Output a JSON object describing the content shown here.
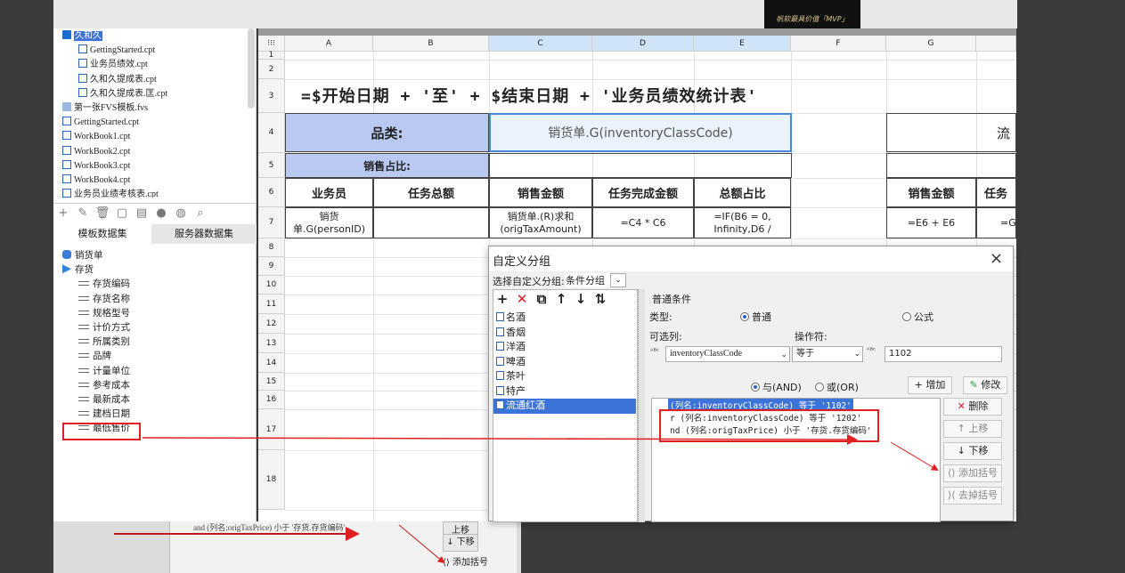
{
  "colors": {
    "accent": "#3b73d8",
    "annotation_red": "#e02020",
    "header_blue": "#b9c9f2"
  },
  "background": {
    "mvp_badge": "帆软最具价值「MVP」",
    "bottom_ghost": {
      "cond_text": "and (列名:origTaxPrice) 小于 '存货.存货编码'",
      "up": "上移",
      "down": "下移",
      "add_paren": "添加括号"
    }
  },
  "file_tree": {
    "items": [
      {
        "label": "久和久",
        "type": "folder",
        "indent": 0,
        "selected": true
      },
      {
        "label": "GettingStarted.cpt",
        "type": "file",
        "indent": 1
      },
      {
        "label": "业务员绩效.cpt",
        "type": "file",
        "indent": 1
      },
      {
        "label": "久和久提成表.cpt",
        "type": "file",
        "indent": 1
      },
      {
        "label": "久和久提成表.匡.cpt",
        "type": "file",
        "indent": 1
      },
      {
        "label": "第一张FVS模板.fvs",
        "type": "fvs",
        "indent": 0
      },
      {
        "label": "GettingStarted.cpt",
        "type": "file",
        "indent": 0
      },
      {
        "label": "WorkBook1.cpt",
        "type": "file",
        "indent": 0
      },
      {
        "label": "WorkBook2.cpt",
        "type": "file",
        "indent": 0
      },
      {
        "label": "WorkBook3.cpt",
        "type": "file",
        "indent": 0
      },
      {
        "label": "WorkBook4.cpt",
        "type": "file",
        "indent": 0
      },
      {
        "label": "业务员业绩考核表.cpt",
        "type": "file",
        "indent": 0
      }
    ]
  },
  "dataset_panel": {
    "toolbar_icons": [
      "add-icon",
      "edit-icon",
      "delete-icon",
      "preview-icon",
      "server-icon",
      "db-icon",
      "db2-icon",
      "search-icon"
    ],
    "tabs": {
      "template": "模板数据集",
      "server": "服务器数据集"
    },
    "datasets": [
      {
        "label": "销货单",
        "kind": "db"
      },
      {
        "label": "存货",
        "kind": "table"
      }
    ],
    "fields": [
      "存货编码",
      "存货名称",
      "规格型号",
      "计价方式",
      "所属类别",
      "品牌",
      "计量单位",
      "参考成本",
      "最新成本",
      "建档日期",
      "最低售价"
    ]
  },
  "sheet": {
    "columns": [
      "A",
      "B",
      "C",
      "D",
      "E",
      "F",
      "G",
      ""
    ],
    "rows": [
      "1",
      "2",
      "3",
      "4",
      "5",
      "6",
      "7",
      "8",
      "9",
      "10",
      "11",
      "12",
      "13",
      "14",
      "15",
      "16",
      "17",
      "18"
    ],
    "title": "=$开始日期 + '至' + $结束日期 + '业务员绩效统计表'",
    "category_label": "品类:",
    "category_value": "销货单.G(inventoryClassCode)",
    "sales_share": "销售占比:",
    "right_label": "流",
    "headers": [
      "业务员",
      "任务总额",
      "销售金额",
      "任务完成金额",
      "总额占比",
      "销售金额",
      "任务"
    ],
    "row6": [
      "销货单.G(personID)",
      "",
      "销货单.(R)求和(origTaxAmount)",
      "=C4 * C6",
      "=IF(B6 = 0, Infinity,D6 /",
      "=E6 + E6",
      "=G"
    ]
  },
  "dialog": {
    "title": "自定义分组",
    "select_label": "选择自定义分组:",
    "select_value": "条件分组",
    "group_toolbar": [
      "+",
      "✕",
      "⧉",
      "↑",
      "↓",
      "⇅"
    ],
    "groups": [
      "名酒",
      "香烟",
      "洋酒",
      "啤酒",
      "茶叶",
      "特产",
      "流通红酒"
    ],
    "selected_group": "流通红酒",
    "normal_condition": "普通条件",
    "type_label": "类型:",
    "type_normal": "普通",
    "type_formula": "公式",
    "column_label": "可选列:",
    "operator_label": "操作符:",
    "column_value": "inventoryClassCode",
    "operator_value": "等于",
    "value": "1102",
    "and_label": "与(AND)",
    "or_label": "或(OR)",
    "add_button": "增加",
    "modify_button": "修改",
    "delete_button": "删除",
    "up_button": "上移",
    "down_button": "下移",
    "add_paren_button": "添加括号",
    "remove_paren_button": "去掉括号",
    "conditions": [
      "(列名:inventoryClassCode) 等于 '1102'",
      "r (列名:inventoryClassCode) 等于 '1202'",
      "nd (列名:origTaxPrice) 小于 '存货.存货编码'"
    ]
  }
}
